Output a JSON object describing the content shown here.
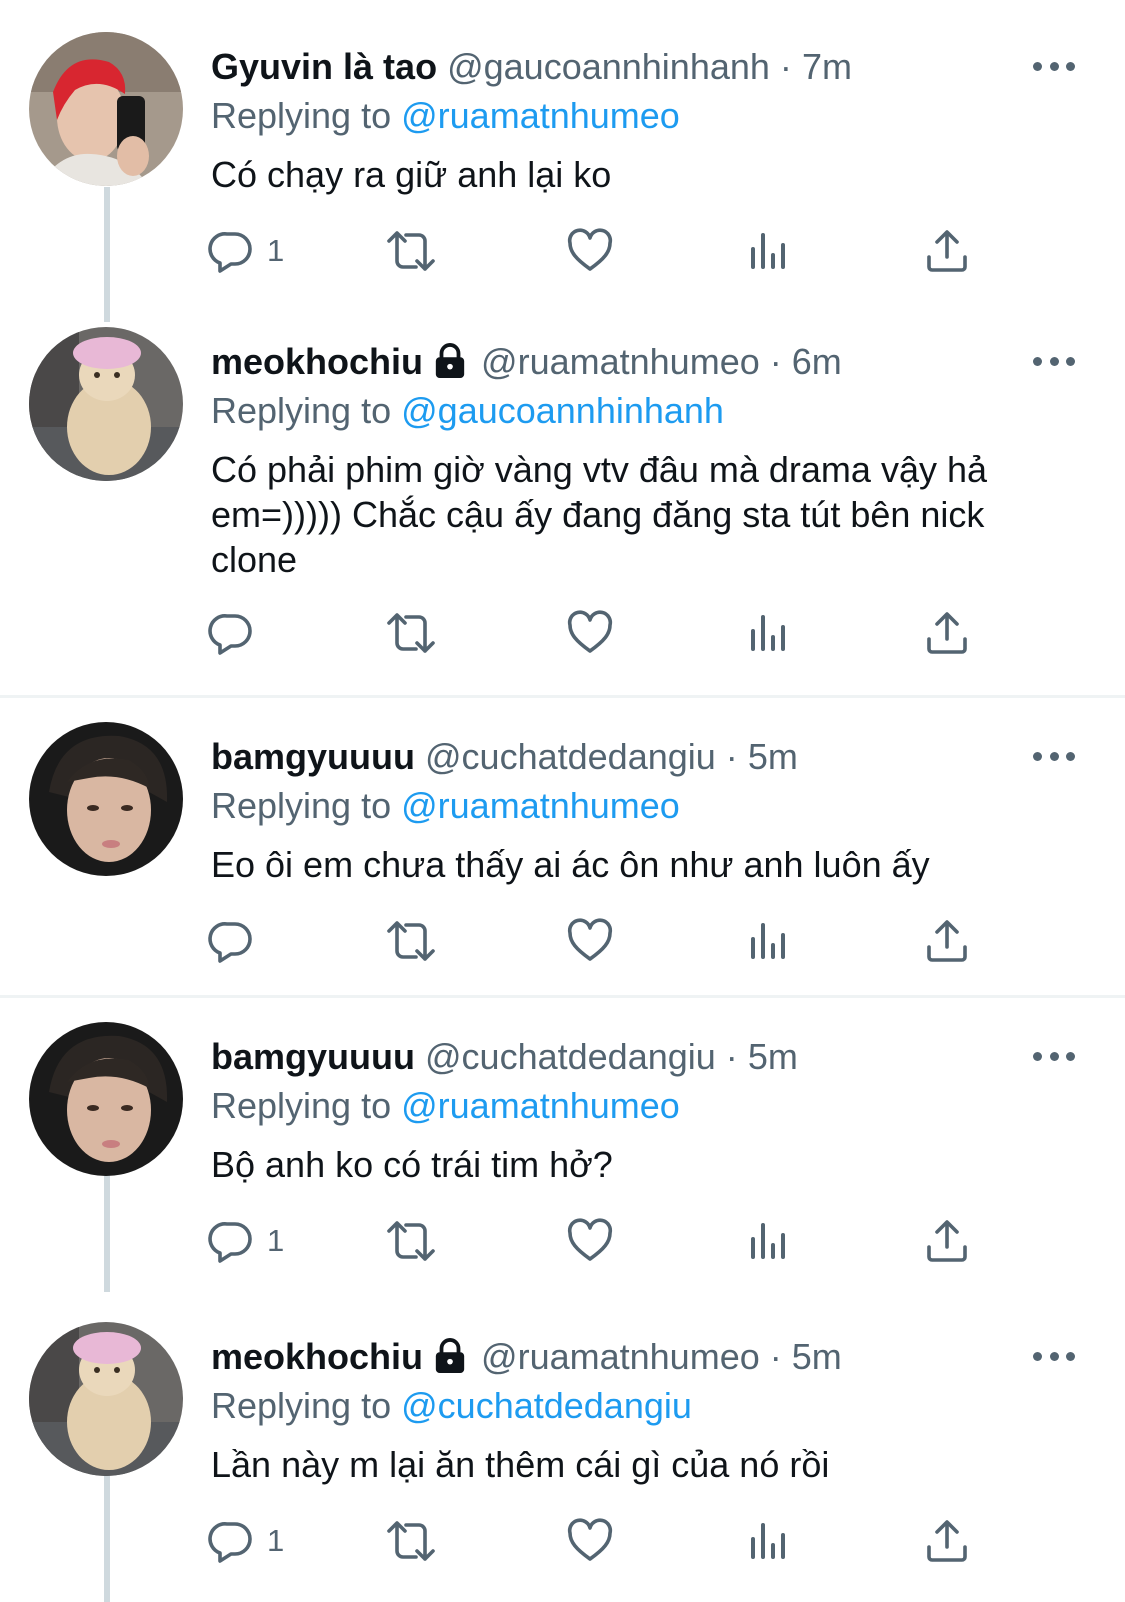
{
  "colors": {
    "accent": "#1d9bf0",
    "secondary_text": "#536471",
    "primary_text": "#0f1419",
    "thread_line": "#cfd9de"
  },
  "icons": [
    "reply-icon",
    "retweet-icon",
    "like-icon",
    "views-icon",
    "share-icon",
    "more-icon",
    "lock-icon"
  ],
  "replying_label": "Replying to",
  "dot": "·",
  "tweets": [
    {
      "name": "Gyuvin là tao",
      "handle": "@gaucoannhinhanh",
      "time": "7m",
      "replying_to": "@ruamatnhumeo",
      "text": "Có chạy ra giữ anh lại ko",
      "reply_count": "1",
      "locked": false
    },
    {
      "name": "meokhochiu",
      "handle": "@ruamatnhumeo",
      "time": "6m",
      "replying_to": "@gaucoannhinhanh",
      "text": "Có phải phim giờ vàng vtv đâu mà drama vậy hả em=))))) Chắc cậu ấy đang đăng sta tút bên nick clone",
      "reply_count": "",
      "locked": true
    },
    {
      "name": "bamgyuuuu",
      "handle": "@cuchatdedangiu",
      "time": "5m",
      "replying_to": "@ruamatnhumeo",
      "text": "Eo ôi em chưa thấy ai ác ôn như anh luôn ấy",
      "reply_count": "",
      "locked": false
    },
    {
      "name": "bamgyuuuu",
      "handle": "@cuchatdedangiu",
      "time": "5m",
      "replying_to": "@ruamatnhumeo",
      "text": "Bộ anh ko có trái tim hở?",
      "reply_count": "1",
      "locked": false
    },
    {
      "name": "meokhochiu",
      "handle": "@ruamatnhumeo",
      "time": "5m",
      "replying_to": "@cuchatdedangiu",
      "text": "Lần này m lại ăn thêm cái gì của nó rồi",
      "reply_count": "1",
      "locked": true
    }
  ]
}
